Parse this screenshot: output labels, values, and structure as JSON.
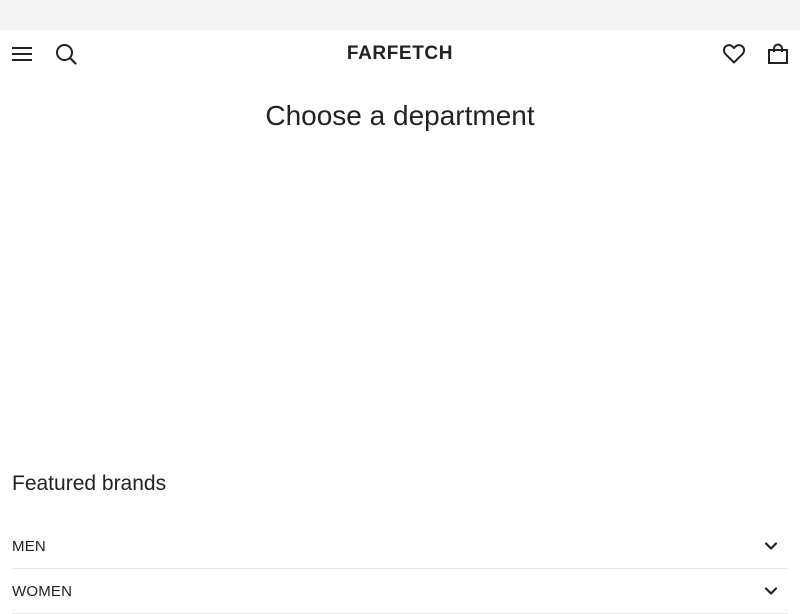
{
  "header": {
    "logo_text": "FARFETCH",
    "icons": {
      "menu": "hamburger-menu-icon",
      "search": "search-icon",
      "wishlist": "heart-icon",
      "bag": "shopping-bag-icon"
    }
  },
  "main": {
    "title": "Choose a department"
  },
  "featured": {
    "title": "Featured brands",
    "items": [
      {
        "label": "MEN"
      },
      {
        "label": "WOMEN"
      }
    ]
  },
  "colors": {
    "banner_bg": "#f5f5f5",
    "text": "#222222",
    "divider": "#e6e6e6",
    "background": "#ffffff"
  }
}
